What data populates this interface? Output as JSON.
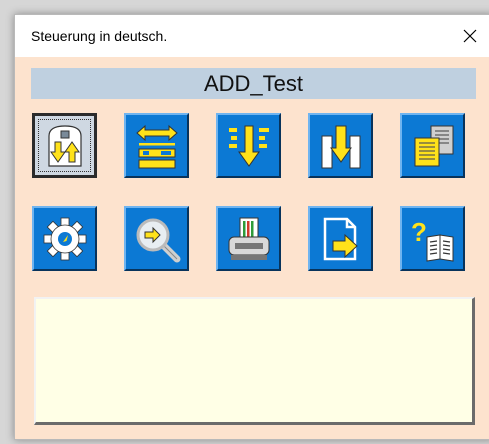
{
  "window": {
    "title": "Steuerung in deutsch.",
    "close_glyph": "✕"
  },
  "header": {
    "title": "ADD_Test",
    "background": "#bfd0e0"
  },
  "colors": {
    "window_bg": "#fde3ce",
    "tile_blue": "#0c79d4",
    "icon_yellow": "#ffe21a",
    "message_bg": "#ffffe6"
  },
  "toolbar": {
    "row1": [
      {
        "name": "exchange-icon",
        "selected": true
      },
      {
        "name": "transfer-list-icon",
        "selected": false
      },
      {
        "name": "sort-down-icon",
        "selected": false
      },
      {
        "name": "insert-down-icon",
        "selected": false
      },
      {
        "name": "documents-icon",
        "selected": false
      }
    ],
    "row2": [
      {
        "name": "settings-gear-icon",
        "selected": false
      },
      {
        "name": "search-icon",
        "selected": false
      },
      {
        "name": "print-icon",
        "selected": false
      },
      {
        "name": "export-document-icon",
        "selected": false
      },
      {
        "name": "help-book-icon",
        "selected": false
      }
    ]
  },
  "message_area": {
    "text": ""
  }
}
